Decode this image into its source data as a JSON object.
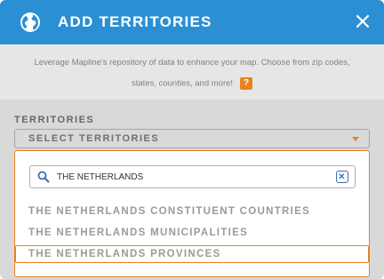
{
  "header": {
    "title": "ADD TERRITORIES"
  },
  "description": {
    "line1": "Leverage Mapline's repository of data to enhance your map. Choose from zip codes,",
    "line2": "states, counties, and more!",
    "help_badge": "?"
  },
  "territories": {
    "label": "TERRITORIES",
    "select_placeholder": "SELECT TERRITORIES"
  },
  "search": {
    "value": "THE NETHERLANDS"
  },
  "options": [
    {
      "label": "THE NETHERLANDS CONSTITUENT COUNTRIES"
    },
    {
      "label": "THE NETHERLANDS MUNICIPALITIES"
    },
    {
      "label": "THE NETHERLANDS PROVINCES"
    }
  ],
  "colors": {
    "header": "#2b8fd4",
    "accent": "#e8831f",
    "clear_icon": "#3a6fb5"
  },
  "icons": {
    "header": "globe-icon",
    "close": "close-icon",
    "search": "search-icon",
    "clear": "clear-x-icon",
    "caret": "caret-down-icon"
  }
}
